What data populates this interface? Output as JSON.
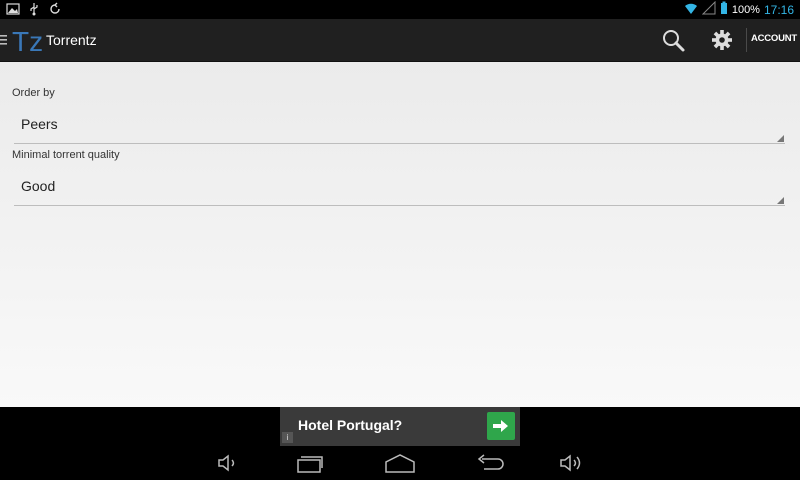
{
  "status_bar": {
    "battery": "100%",
    "time": "17:16",
    "icons": [
      "image-notification-icon",
      "usb-icon",
      "sync-icon",
      "wifi-icon",
      "signal-icon",
      "battery-icon"
    ]
  },
  "action_bar": {
    "title": "Torrentz",
    "logo_letter": "Tz",
    "account_label": "ACCOUNT",
    "icons": [
      "drawer-icon",
      "search-icon",
      "gear-icon"
    ]
  },
  "settings": {
    "order_by": {
      "label": "Order by",
      "value": "Peers"
    },
    "quality": {
      "label": "Minimal torrent quality",
      "value": "Good"
    }
  },
  "ad": {
    "title": "Hotel Portugal?",
    "info": "i",
    "icons": [
      "arrow-right-icon",
      "info-icon"
    ]
  },
  "nav_bar": {
    "icons": [
      "volume-down-icon",
      "recent-apps-icon",
      "home-icon",
      "back-icon",
      "volume-up-icon"
    ]
  },
  "colors": {
    "accent": "#33b5e5",
    "action_bar": "#202020",
    "ad_cta": "#2fa64b",
    "logo_blue": "#3a78b8"
  }
}
